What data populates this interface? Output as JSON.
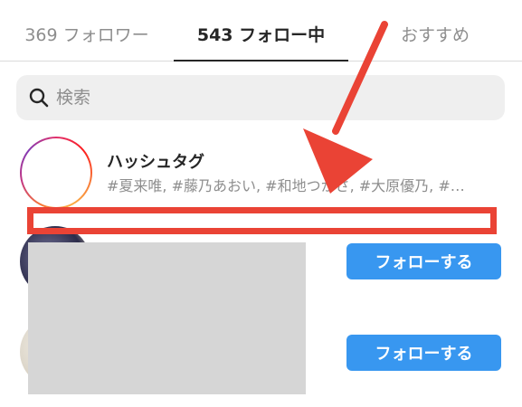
{
  "tabs": [
    {
      "label": "369 フォロワー"
    },
    {
      "label": "543 フォロー中"
    },
    {
      "label": "おすすめ"
    }
  ],
  "search": {
    "placeholder": "検索"
  },
  "hashtag_row": {
    "title": "ハッシュタグ",
    "subtitle": "#夏来唯, #藤乃あおい, #和地つかさ, #大原優乃, #…"
  },
  "users": [
    {
      "follow_label": "フォローする"
    },
    {
      "follow_label": "フォローする"
    }
  ],
  "colors": {
    "accent_blue": "#3897f0",
    "annotation_red": "#ea4335",
    "redaction_gray": "#d6d6d6"
  },
  "icons": [
    "search-icon",
    "hashtag-icon",
    "arrow-annotation"
  ]
}
